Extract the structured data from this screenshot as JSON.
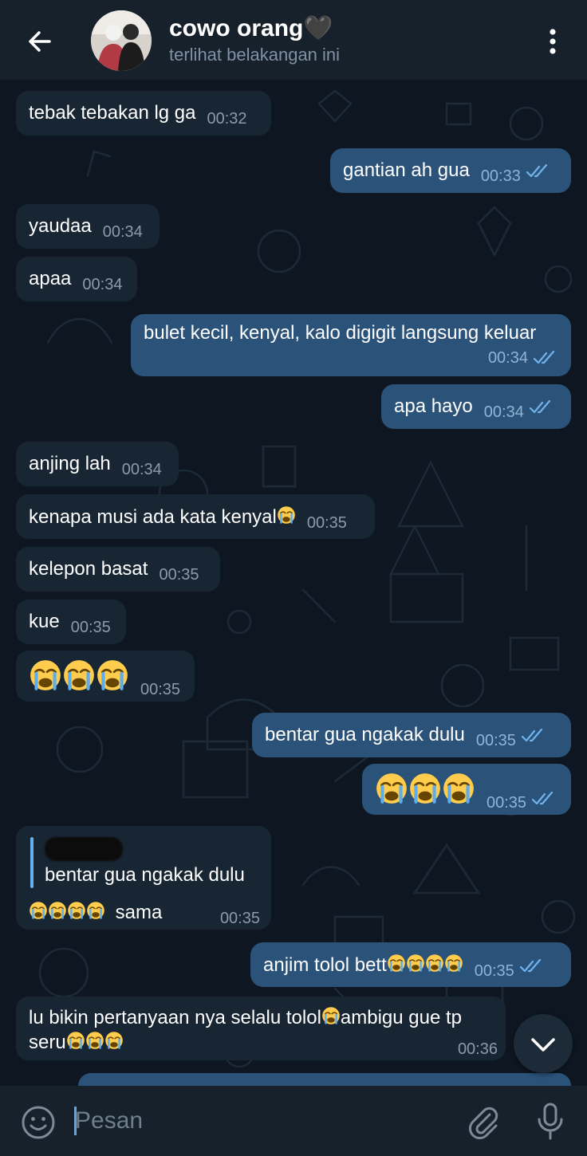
{
  "header": {
    "title": "cowo orang🖤",
    "status": "terlihat belakangan ini",
    "back_icon": "arrow-left-icon",
    "menu_icon": "more-vertical-icon"
  },
  "colors": {
    "header_bg": "#17212b",
    "chat_bg": "#0e1621",
    "incoming_bubble": "#182533",
    "outgoing_bubble": "#2b5278",
    "read_ticks": "#6fb3ef",
    "reply_accent": "#62b0f0"
  },
  "messages": {
    "m1": {
      "text": "tebak tebakan lg ga",
      "time": "00:32"
    },
    "m2": {
      "text": "gantian ah gua",
      "time": "00:33"
    },
    "m3": {
      "text": "yaudaa",
      "time": "00:34"
    },
    "m4": {
      "text": "apaa",
      "time": "00:34"
    },
    "m5": {
      "text": "bulet kecil, kenyal, kalo digigit langsung keluar",
      "time": "00:34"
    },
    "m6": {
      "text": "apa hayo",
      "time": "00:34"
    },
    "m7": {
      "text": "anjing lah",
      "time": "00:34"
    },
    "m8": {
      "text": "kenapa musi ada kata kenyal",
      "time": "00:35"
    },
    "m9": {
      "text": "kelepon basat",
      "time": "00:35"
    },
    "m10": {
      "text": "kue",
      "time": "00:35"
    },
    "m11": {
      "time": "00:35"
    },
    "m12": {
      "text": "bentar gua ngakak dulu",
      "time": "00:35"
    },
    "m13": {
      "time": "00:35"
    },
    "m14": {
      "reply_text": "bentar gua ngakak dulu",
      "text": "sama",
      "time": "00:35"
    },
    "m15": {
      "text": "anjim tolol bett",
      "time": "00:35"
    },
    "m16": {
      "text_a": "lu bikin pertanyaan nya selalu tolol",
      "text_b": "ambigu gue tp",
      "text_c": "seru",
      "time": "00:36"
    }
  },
  "composer": {
    "placeholder": "Pesan",
    "emoji_icon": "smiley-icon",
    "attach_icon": "paperclip-icon",
    "mic_icon": "microphone-icon"
  },
  "scroll_down_icon": "chevron-down-icon"
}
